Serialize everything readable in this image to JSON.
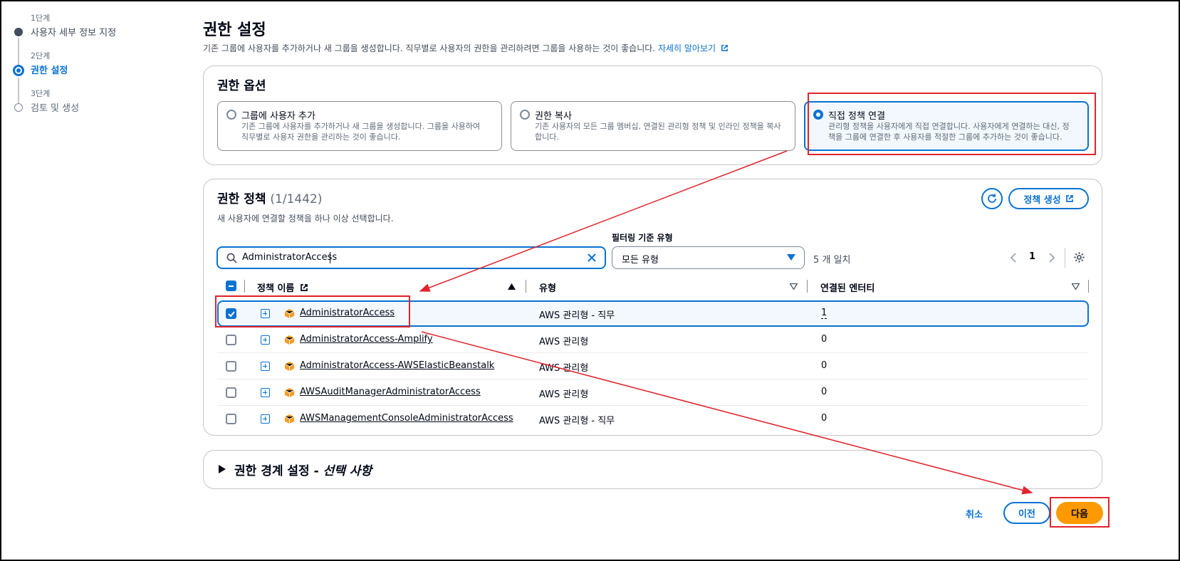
{
  "steps": [
    {
      "number": "1단계",
      "label": "사용자 세부 정보 지정",
      "state": "completed"
    },
    {
      "number": "2단계",
      "label": "권한 설정",
      "state": "current"
    },
    {
      "number": "3단계",
      "label": "검토 및 생성",
      "state": "upcoming"
    }
  ],
  "page": {
    "title": "권한 설정",
    "description": "기존 그룹에 사용자를 추가하거나 새 그룹을 생성합니다. 직무별로 사용자의 권한을 관리하려면 그룹을 사용하는 것이 좋습니다.",
    "learn_more": "자세히 알아보기"
  },
  "options": {
    "title": "권한 옵션",
    "tiles": [
      {
        "title": "그룹에 사용자 추가",
        "desc1": "기존 그룹에 사용자를 추가하거나 새 그룹을 생성합니다. 그룹을 사용하여",
        "desc2": "직무별로 사용자 권한을 관리하는 것이 좋습니다.",
        "selected": false
      },
      {
        "title": "권한 복사",
        "desc1": "기존 사용자의 모든 그룹 멤버십, 연결된 관리형 정책 및 인라인 정책을 복사",
        "desc2": "합니다.",
        "selected": false
      },
      {
        "title": "직접 정책 연결",
        "desc1": "관리형 정책을 사용자에게 직접 연결합니다. 사용자에게 연결하는 대신, 정",
        "desc2": "책을 그룹에 연결한 후 사용자를 적절한 그룹에 추가하는 것이 좋습니다.",
        "selected": true
      }
    ]
  },
  "policies": {
    "title": "권한 정책",
    "count": "(1/1442)",
    "description": "새 사용자에 연결할 정책을 하나 이상 선택합니다.",
    "create_button": "정책 생성",
    "filter_label": "필터링 기준 유형",
    "search_value": "AdministratorAccess",
    "type_filter_value": "모든 유형",
    "match_count": "5 개 일치",
    "page_number": "1",
    "columns": {
      "name": "정책 이름",
      "type": "유형",
      "entities": "연결된 엔터티"
    },
    "rows": [
      {
        "name": "AdministratorAccess",
        "type": "AWS 관리형 - 직무",
        "entities": "1",
        "checked": true
      },
      {
        "name": "AdministratorAccess-Amplify",
        "type": "AWS 관리형",
        "entities": "0",
        "checked": false
      },
      {
        "name": "AdministratorAccess-AWSElasticBeanstalk",
        "type": "AWS 관리형",
        "entities": "0",
        "checked": false
      },
      {
        "name": "AWSAuditManagerAdministratorAccess",
        "type": "AWS 관리형",
        "entities": "0",
        "checked": false
      },
      {
        "name": "AWSManagementConsoleAdministratorAccess",
        "type": "AWS 관리형 - 직무",
        "entities": "0",
        "checked": false
      }
    ]
  },
  "boundary": {
    "title": "권한 경계 설정 - ",
    "optional": "선택 사항"
  },
  "footer": {
    "cancel": "취소",
    "previous": "이전",
    "next": "다음"
  },
  "colors": {
    "accent": "#0972d3",
    "primary_button": "#ff9900",
    "annotation": "#e0242b"
  }
}
